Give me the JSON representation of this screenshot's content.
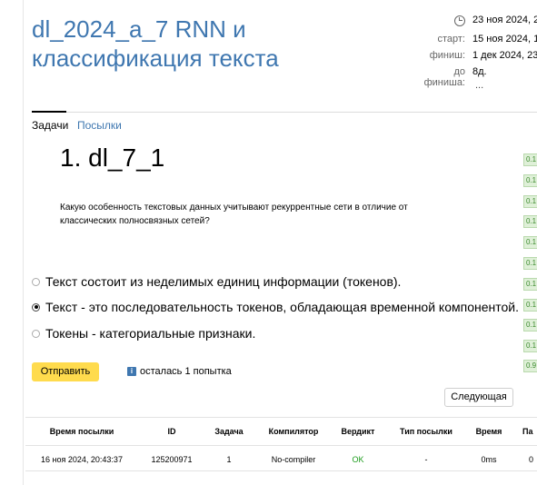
{
  "contest": {
    "title": "dl_2024_a_7 RNN и классификация текста",
    "current_time": "23 ноя 2024, 2",
    "start_label": "старт:",
    "start_value": "15 ноя 2024, 1",
    "finish_label": "финиш:",
    "finish_value": "1 дек 2024, 23",
    "remaining_label": "до финиша:",
    "remaining_value": "8д.",
    "more": "..."
  },
  "tabs": {
    "tasks": "Задачи",
    "submissions": "Посылки"
  },
  "problem": {
    "title": "1. dl_7_1",
    "statement": "Какую особенность текстовых данных учитывают рекуррентные сети в отличие от классических полносвязных сетей?",
    "options": [
      {
        "text": "Текст состоит из неделимых единиц информации (токенов).",
        "selected": false
      },
      {
        "text": "Текст - это последовательность токенов, обладающая временной компонентой.",
        "selected": true
      },
      {
        "text": "Токены - категориальные признаки.",
        "selected": false
      }
    ],
    "submit_label": "Отправить",
    "attempts_text": "осталась 1 попытка",
    "next_label": "Следующая"
  },
  "table": {
    "headers": [
      "Время посылки",
      "ID",
      "Задача",
      "Компилятор",
      "Вердикт",
      "Тип посылки",
      "Время",
      "Па"
    ],
    "rows": [
      [
        "16 ноя 2024, 20:43:37",
        "125200971",
        "1",
        "No-compiler",
        "OK",
        "-",
        "0ms",
        "0"
      ]
    ]
  },
  "scores": [
    "0.1",
    "0.1",
    "0.1",
    "0.1",
    "0.1",
    "0.1",
    "0.1",
    "0.1",
    "0.1",
    "0.1",
    "0.1",
    "0.9"
  ],
  "colors": {
    "link": "#3f77b0",
    "submit": "#ffdb4d",
    "ok": "#1f9d1f",
    "score_bg": "#dff0d8"
  }
}
